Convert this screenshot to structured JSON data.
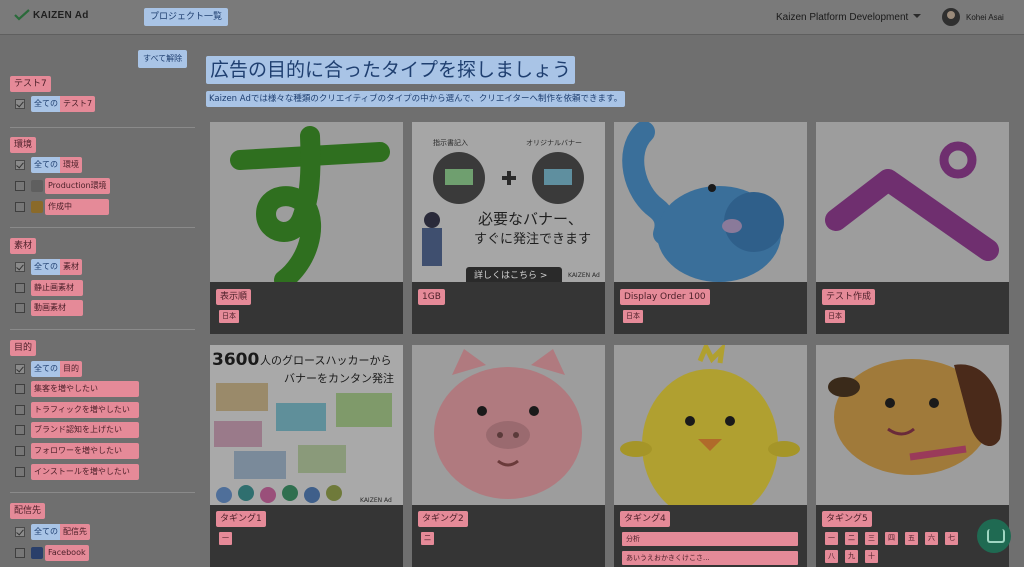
{
  "header": {
    "logo_text": "KAIZEN Ad",
    "nav_button": "プロジェクト一覧",
    "org_name": "Kaizen Platform Development",
    "user_name": "Kohei Asai"
  },
  "sidebar": {
    "clear_all": "すべて解除",
    "groups": [
      {
        "title": "テスト7",
        "all_prefix": "全ての",
        "all_label": "テスト7",
        "options": []
      },
      {
        "title": "環境",
        "all_prefix": "全ての",
        "all_label": "環境",
        "options": [
          "Production環境",
          "作成中"
        ]
      },
      {
        "title": "素材",
        "all_prefix": "全ての",
        "all_label": "素材",
        "options": [
          "静止画素材",
          "動画素材"
        ]
      },
      {
        "title": "目的",
        "all_prefix": "全ての",
        "all_label": "目的",
        "options": [
          "集客を増やしたい",
          "トラフィックを増やしたい",
          "ブランド認知を上げたい",
          "フォロワーを増やしたい",
          "インストールを増やしたい"
        ]
      },
      {
        "title": "配信先",
        "all_prefix": "全ての",
        "all_label": "配信先",
        "options": [
          "Facebook"
        ]
      }
    ]
  },
  "main": {
    "title": "広告の目的に合ったタイプを探しましょう",
    "subtitle": "Kaizen Adでは様々な種類のクリエイティブのタイプの中から選んで、クリエイターへ制作を依頼できます。",
    "cards": [
      {
        "label": "表示順",
        "tags": [
          "日本"
        ],
        "art": "hiragana-su"
      },
      {
        "label": "1GB",
        "tags": [],
        "art": "banner-order",
        "art_text": {
          "left": "指示書記入",
          "right": "オリジナルバナー",
          "headline1": "必要なバナー、",
          "headline2": "すぐに発注できます",
          "cta": "詳しくはこちら >",
          "brand": "KAIZEN Ad"
        }
      },
      {
        "label": "Display Order 100",
        "tags": [
          "日本"
        ],
        "art": "hiragana-shi"
      },
      {
        "label": "テスト作成",
        "tags": [
          "日本"
        ],
        "art": "hiragana-pe"
      },
      {
        "label": "タギング1",
        "tags": [
          "一"
        ],
        "art": "growth-hacker",
        "art_text": {
          "line1a": "3600",
          "line1b": "人のグロースハッカーから",
          "line2": "バナーをカンタン発注",
          "brand": "KAIZEN Ad"
        }
      },
      {
        "label": "タギング2",
        "tags": [
          "二"
        ],
        "art": "pig"
      },
      {
        "label": "タギング4",
        "tags": [],
        "bars": [
          "分析",
          "あいうえおかきくけこさ..."
        ],
        "art": "chick"
      },
      {
        "label": "タギング5",
        "tags": [
          "一",
          "二",
          "三",
          "四",
          "五",
          "六",
          "七",
          "八",
          "九",
          "十"
        ],
        "art": "dog"
      }
    ]
  },
  "colors": {
    "highlight_pink": "#e58a98",
    "highlight_blue": "#a9c4e6",
    "overlay_gray": "#6f6f6f",
    "card_footer": "#353535"
  }
}
